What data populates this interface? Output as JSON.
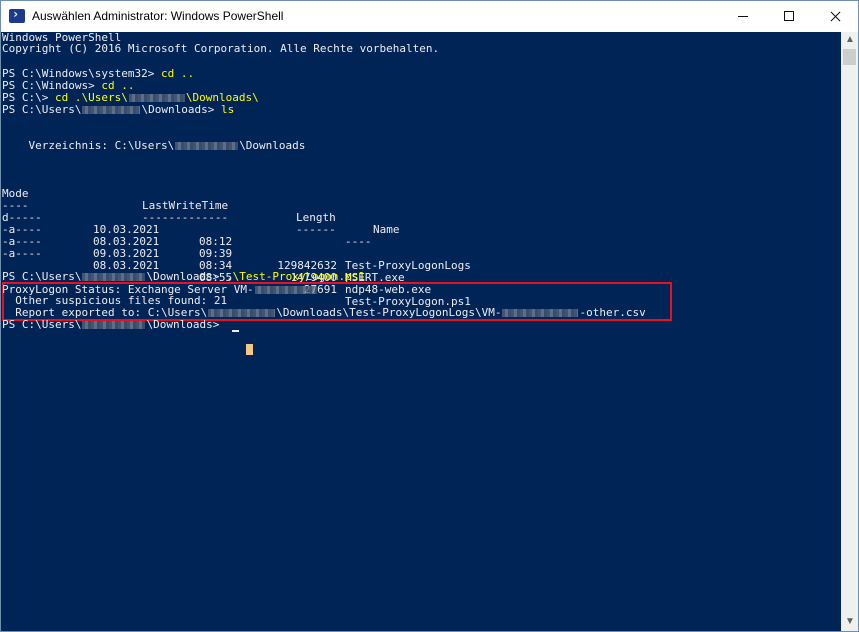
{
  "window": {
    "title": "Auswählen Administrator: Windows PowerShell",
    "app_icon": "powershell-icon",
    "minimize_icon": "minimize-icon",
    "maximize_icon": "maximize-icon",
    "close_icon": "close-icon"
  },
  "console": {
    "banner1": "Windows PowerShell",
    "banner2": "Copyright (C) 2016 Microsoft Corporation. Alle Rechte vorbehalten.",
    "cmd1_prompt": "PS C:\\Windows\\system32> ",
    "cmd1_cmd": "cd ..",
    "cmd2_prompt": "PS C:\\Windows> ",
    "cmd2_cmd": "cd ..",
    "cmd3_prompt": "PS C:\\> ",
    "cmd3_cmd": "cd .\\Users\\",
    "cmd3_tail": "\\Downloads\\",
    "cmd4_prompt": "PS C:\\Users\\",
    "cmd4_tail": "\\Downloads> ",
    "cmd4_cmd": "ls",
    "dir_label": "    Verzeichnis: C:\\Users\\",
    "dir_tail": "\\Downloads",
    "headers": {
      "mode": "Mode",
      "time": "LastWriteTime",
      "length": "Length",
      "name": "Name"
    },
    "header_underlines": {
      "mode": "----",
      "time": "-------------",
      "length": "------",
      "name": "----"
    },
    "files": [
      {
        "mode": "d-----",
        "date": "10.03.2021",
        "time": "08:12",
        "length": "",
        "name": "Test-ProxyLogonLogs"
      },
      {
        "mode": "-a----",
        "date": "08.03.2021",
        "time": "09:39",
        "length": "129842632",
        "name": "MSERT.exe"
      },
      {
        "mode": "-a----",
        "date": "09.03.2021",
        "time": "08:34",
        "length": "1479400",
        "name": "ndp48-web.exe"
      },
      {
        "mode": "-a----",
        "date": "08.03.2021",
        "time": "08:55",
        "length": "27691",
        "name": "Test-ProxyLogon.ps1"
      }
    ],
    "cmd5_prompt": "PS C:\\Users\\",
    "cmd5_tail": "\\Downloads> ",
    "cmd5_cmd": ".\\Test-ProxyLogon.ps1",
    "status_line": "ProxyLogon Status: Exchange Server VM-",
    "suspicious_line": "  Other suspicious files found: 21",
    "report_prefix": "  Report exported to: C:\\Users\\",
    "report_mid": "\\Downloads\\Test-ProxyLogonLogs\\VM-",
    "report_suffix": "-other.csv",
    "cmd6_prompt": "PS C:\\Users\\",
    "cmd6_tail": "\\Downloads> "
  },
  "colors": {
    "console_bg": "#012456",
    "text": "#eeedf0",
    "command": "#ffff00",
    "highlight_border": "#e81123",
    "cursor": "#f2c889"
  }
}
